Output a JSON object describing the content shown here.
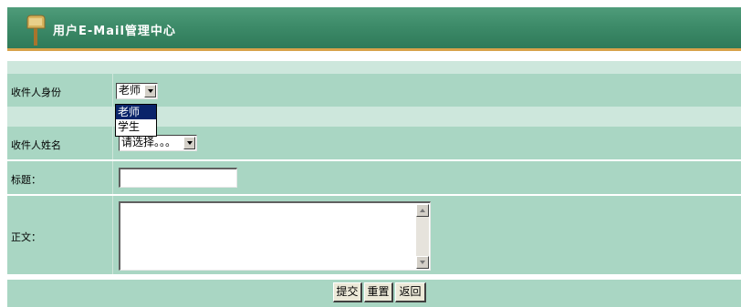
{
  "header": {
    "title": "用户E-Mail管理中心"
  },
  "form": {
    "recipient_identity": {
      "label": "收件人身份",
      "selected": "老师",
      "options": [
        "老师",
        "学生"
      ]
    },
    "recipient_name": {
      "label": "收件人姓名",
      "selected": "请选择。。。"
    },
    "subject": {
      "label": "标题：",
      "value": ""
    },
    "body": {
      "label": "正文：",
      "value": ""
    }
  },
  "buttons": {
    "submit": "提交",
    "reset": "重置",
    "back": "返回"
  },
  "colors": {
    "header_bg": "#3d8b69",
    "header_border": "#d8a24a",
    "row_bg": "#a9d6c3",
    "gap_bg": "#cde7dc"
  }
}
